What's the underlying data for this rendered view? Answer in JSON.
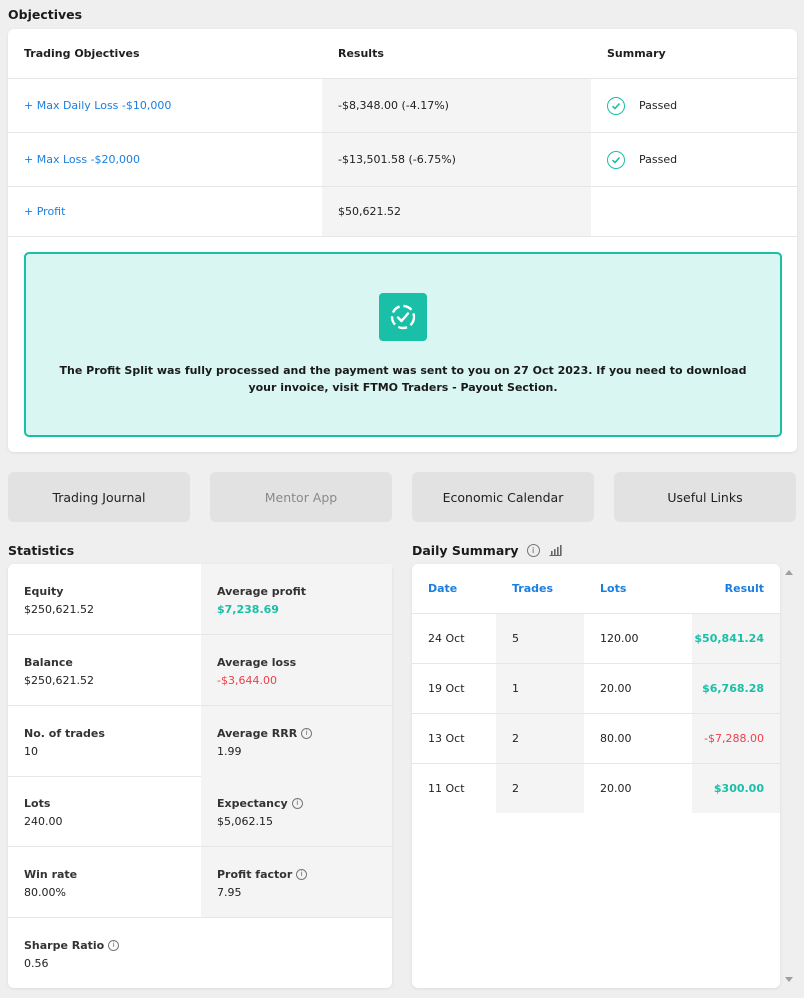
{
  "objectives": {
    "title": "Objectives",
    "headers": [
      "Trading Objectives",
      "Results",
      "Summary"
    ],
    "rows": [
      {
        "objective": "Max Daily Loss -$10,000",
        "result": "-$8,348.00 (-4.17%)",
        "summary": "Passed"
      },
      {
        "objective": "Max Loss -$20,000",
        "result": "-$13,501.58 (-6.75%)",
        "summary": "Passed"
      },
      {
        "objective": "Profit",
        "result": "$50,621.52",
        "summary": ""
      }
    ],
    "plus": "+",
    "banner_text": "The Profit Split was fully processed and the payment was sent to you on 27 Oct 2023. If you need to download your invoice, visit FTMO Traders - Payout Section."
  },
  "buttons": [
    {
      "label": "Trading Journal"
    },
    {
      "label": "Mentor App"
    },
    {
      "label": "Economic Calendar"
    },
    {
      "label": "Useful Links"
    }
  ],
  "statistics": {
    "title": "Statistics",
    "rows": [
      [
        {
          "label": "Equity",
          "value": "$250,621.52"
        },
        {
          "label": "Average profit",
          "value": "$7,238.69"
        }
      ],
      [
        {
          "label": "Balance",
          "value": "$250,621.52"
        },
        {
          "label": "Average loss",
          "value": "-$3,644.00"
        }
      ],
      [
        {
          "label": "No. of trades",
          "value": "10"
        },
        {
          "label": "Average RRR",
          "value": "1.99"
        }
      ],
      [
        {
          "label": "Lots",
          "value": "240.00"
        },
        {
          "label": "Expectancy",
          "value": "$5,062.15"
        }
      ],
      [
        {
          "label": "Win rate",
          "value": "80.00%"
        },
        {
          "label": "Profit factor",
          "value": "7.95"
        }
      ],
      [
        {
          "label": "Sharpe Ratio",
          "value": "0.56"
        }
      ]
    ]
  },
  "daily_summary": {
    "title": "Daily Summary",
    "headers": [
      "Date",
      "Trades",
      "Lots",
      "Result"
    ],
    "rows": [
      {
        "date": "24 Oct",
        "trades": "5",
        "lots": "120.00",
        "result": "$50,841.24"
      },
      {
        "date": "19 Oct",
        "trades": "1",
        "lots": "20.00",
        "result": "$6,768.28"
      },
      {
        "date": "13 Oct",
        "trades": "2",
        "lots": "80.00",
        "result": "-$7,288.00"
      },
      {
        "date": "11 Oct",
        "trades": "2",
        "lots": "20.00",
        "result": "$300.00"
      }
    ]
  },
  "info_glyph": "i",
  "colors": {
    "accent": "#19bfa6",
    "link": "#1a7fe0",
    "negative": "#ee3f4b",
    "banner_bg": "#d9f6f2"
  }
}
